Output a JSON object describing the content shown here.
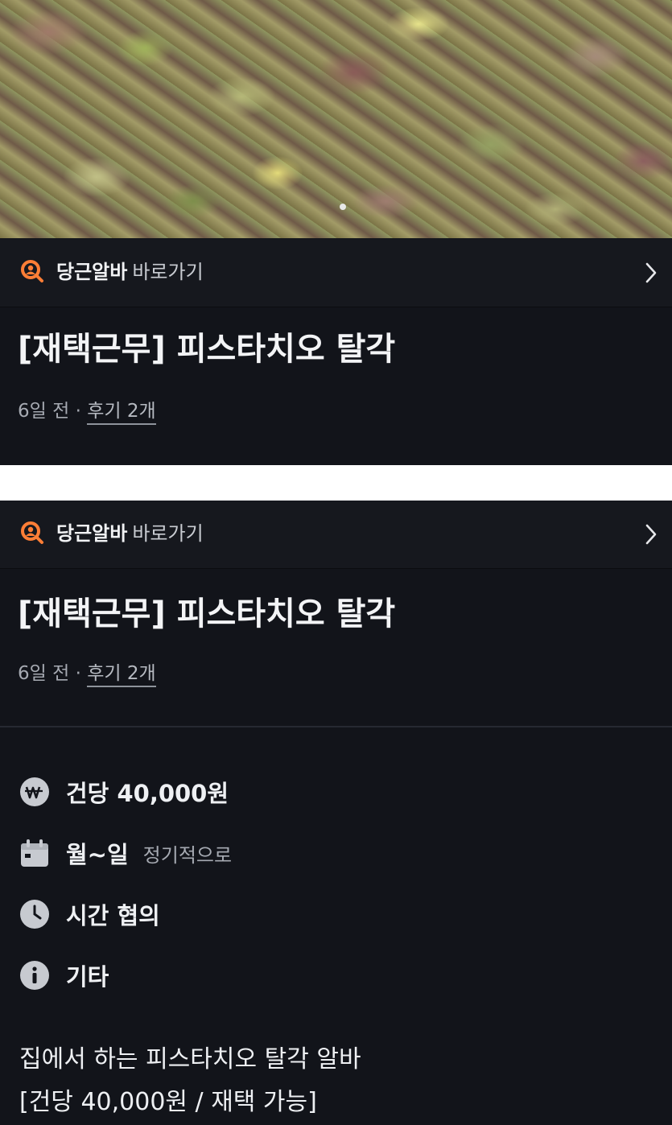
{
  "colors": {
    "background": "#12141a",
    "link_bar": "#16181e",
    "brand_orange": "#ff7e36",
    "icon_gray": "#c7cad0"
  },
  "link_bar": {
    "brand": "당근알바",
    "sub": "바로가기",
    "icon": "daangn-alba-logo-icon",
    "chevron_icon": "chevron-right-icon"
  },
  "post": {
    "title": "[재택근무] 피스타치오 탈각",
    "posted": "6일 전",
    "separator": "·",
    "reviews": "후기 2개"
  },
  "details": {
    "pay": {
      "icon": "won-coin-icon",
      "label": "건당 40,000원"
    },
    "days": {
      "icon": "calendar-icon",
      "label": "월~일",
      "extra": "정기적으로"
    },
    "time": {
      "icon": "clock-icon",
      "label": "시간 협의"
    },
    "other": {
      "icon": "info-icon",
      "label": "기타"
    }
  },
  "description": {
    "line1": "집에서 하는 피스타치오 탈각 알바",
    "line2": "[건당 40,000원 / 재택 가능]"
  }
}
